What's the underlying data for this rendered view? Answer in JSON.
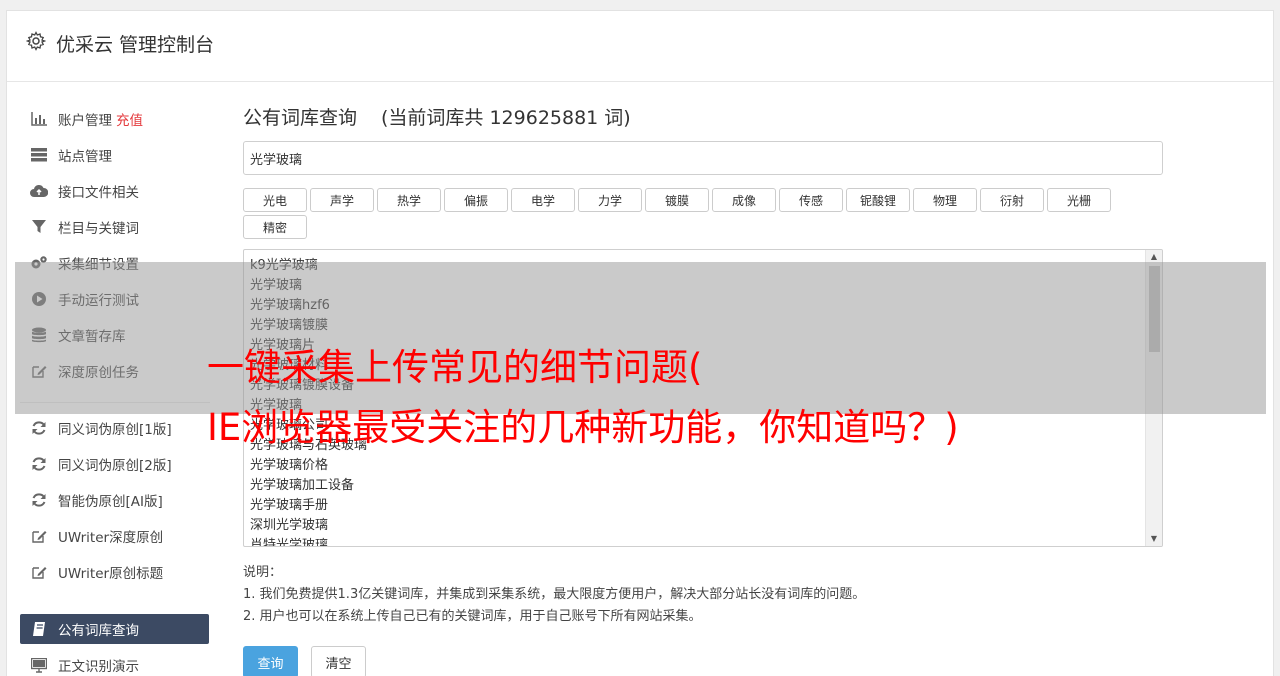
{
  "app": {
    "title": "优采云 管理控制台",
    "icon": "gear-icon"
  },
  "sidebar": {
    "items": [
      {
        "label": "账户管理",
        "badge": "充值",
        "icon": "bar-chart-icon",
        "top": 0
      },
      {
        "label": "站点管理",
        "icon": "server-icon"
      },
      {
        "label": "接口文件相关",
        "icon": "cloud-upload-icon"
      },
      {
        "label": "栏目与关键词",
        "icon": "filter-icon"
      },
      {
        "label": "采集细节设置",
        "icon": "gears-icon"
      },
      {
        "label": "手动运行测试",
        "icon": "play-circle-icon"
      },
      {
        "label": "文章暂存库",
        "icon": "database-icon"
      },
      {
        "label": "深度原创任务",
        "icon": "edit-icon"
      },
      {
        "label": "同义词伪原创[1版]",
        "icon": "refresh-icon"
      },
      {
        "label": "同义词伪原创[2版]",
        "icon": "refresh-icon"
      },
      {
        "label": "智能伪原创[AI版]",
        "icon": "refresh-icon"
      },
      {
        "label": "UWriter深度原创",
        "icon": "edit-icon"
      },
      {
        "label": "UWriter原创标题",
        "icon": "edit-icon"
      },
      {
        "label": "公有词库查询",
        "icon": "book-icon"
      },
      {
        "label": "正文识别演示",
        "icon": "monitor-icon"
      }
    ]
  },
  "main": {
    "title": "公有词库查询",
    "count_text": "(当前词库共 129625881 词)",
    "query_value": "光学玻璃",
    "tags": [
      "光电",
      "声学",
      "热学",
      "偏振",
      "电学",
      "力学",
      "镀膜",
      "成像",
      "传感",
      "铌酸锂",
      "物理",
      "衍射",
      "光栅",
      "精密"
    ],
    "results": [
      "k9光学玻璃",
      "光学玻璃",
      "光学玻璃hzf6",
      "光学玻璃镀膜",
      "光学玻璃片",
      "光学玻璃材料",
      "光学玻璃镀膜设备",
      "光学玻璃",
      "光学玻璃公司",
      "光学玻璃与石英玻璃",
      "光学玻璃价格",
      "光学玻璃加工设备",
      "光学玻璃手册",
      "深圳光学玻璃",
      "肖特光学玻璃"
    ],
    "notes_title": "说明：",
    "notes": [
      "1. 我们免费提供1.3亿关键词库，并集成到采集系统，最大限度方便用户，解决大部分站长没有词库的问题。",
      "2. 用户也可以在系统上传自己已有的关键词库，用于自己账号下所有网站采集。"
    ],
    "query_button": "查询",
    "clear_button": "清空"
  },
  "overlay": {
    "line1": "一键采集上传常见的细节问题(",
    "line2": "IE浏览器最受关注的几种新功能，你知道吗？)"
  },
  "colors": {
    "accent": "#4aa3df",
    "active_nav": "#3c4a63",
    "recharge": "#e4393c",
    "overlay_text": "#ff0000"
  }
}
